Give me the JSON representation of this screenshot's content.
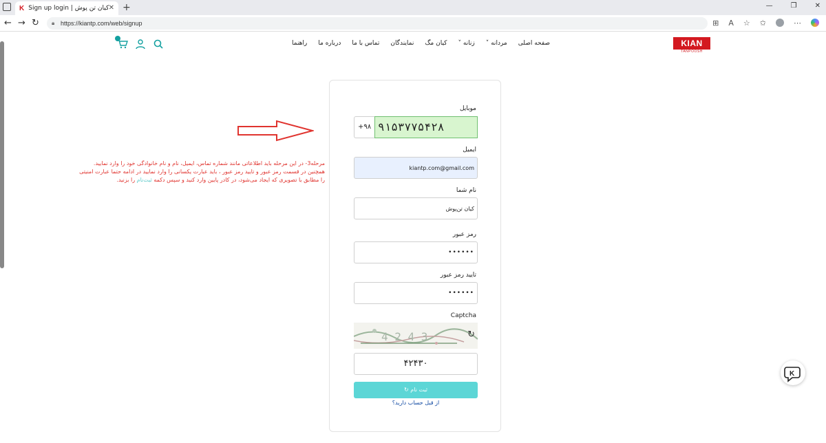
{
  "browser": {
    "tab_title": "Sign up login | کیان تن پوش",
    "tab_icon": "K",
    "url": "https://kiantp.com/web/signup"
  },
  "site": {
    "logo_text": "KIAN",
    "logo_sub": "TANPOOSH",
    "brand_color": "#d31920",
    "accent_color": "#13a0a0",
    "menu": [
      "صفحه اصلی",
      "مردانه ˅",
      "زنانه ˅",
      "کیان مگ",
      "نمایندگان",
      "تماس با ما",
      "درباره ما",
      "راهنما"
    ]
  },
  "form": {
    "mobile_label": "موبایل",
    "phone_code": "+۹۸",
    "phone_value": "۹۱۵۳۷۷۵۴۲۸",
    "email_label": "ایمیل",
    "email_value": "kiantp.com@gmail.com",
    "name_label": "نام شما",
    "name_value": "کیان تن‌پوش",
    "password_label": "رمز عبور",
    "password_value": "••••••",
    "confirm_label": "تایید رمز عبور",
    "confirm_value": "••••••",
    "captcha_label": "Captcha",
    "captcha_code": "۴۲۴۳۰",
    "submit_label": "ثبت نام",
    "login_link": "از قبل حساب دارید؟"
  },
  "annotation": {
    "line1": "مرحله3- در این مرحله باید اطلاعاتی مانند شماره تماس، ایمیل، نام و نام خانوادگی خود را وارد نمایید.",
    "line2": "همچنین در قسمت رمز عبور و تایید رمز عبور ، باید عبارت یکسانی را وارد نمایید در ادامه حتما عبارت امنیتی",
    "line3a": "را مطابق با تصویری که ایجاد می‌شود، در کادر پایین وارد کنید و سپس دکمه",
    "line3b": "ثبت‌نام",
    "line3c": "را بزنید."
  }
}
